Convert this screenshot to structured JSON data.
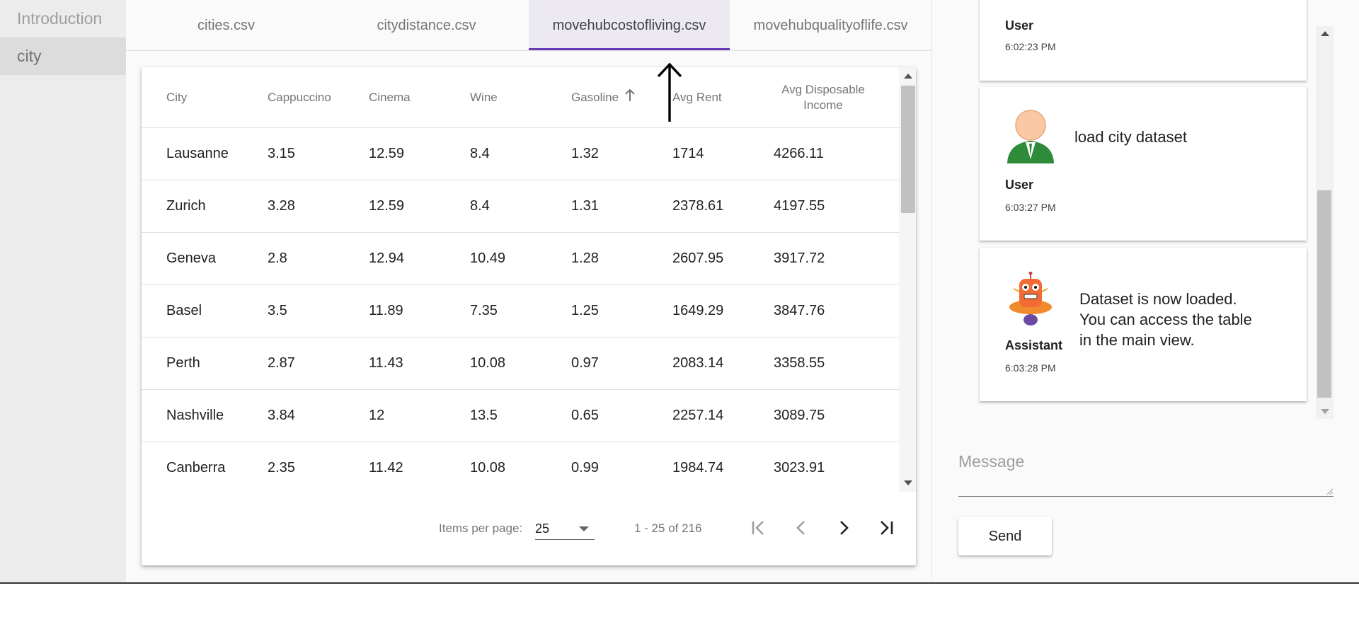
{
  "nav": {
    "items": [
      {
        "label": "Introduction"
      },
      {
        "label": "city"
      }
    ]
  },
  "tabs": [
    {
      "label": "cities.csv"
    },
    {
      "label": "citydistance.csv"
    },
    {
      "label": "movehubcostofliving.csv",
      "active": true
    },
    {
      "label": "movehubqualityoflife.csv"
    }
  ],
  "table": {
    "columns": [
      "City",
      "Cappuccino",
      "Cinema",
      "Wine",
      "Gasoline",
      "Avg Rent",
      "Avg Disposable Income"
    ],
    "sorted_column": "Gasoline",
    "rows": [
      [
        "Lausanne",
        "3.15",
        "12.59",
        "8.4",
        "1.32",
        "1714",
        "4266.11"
      ],
      [
        "Zurich",
        "3.28",
        "12.59",
        "8.4",
        "1.31",
        "2378.61",
        "4197.55"
      ],
      [
        "Geneva",
        "2.8",
        "12.94",
        "10.49",
        "1.28",
        "2607.95",
        "3917.72"
      ],
      [
        "Basel",
        "3.5",
        "11.89",
        "7.35",
        "1.25",
        "1649.29",
        "3847.76"
      ],
      [
        "Perth",
        "2.87",
        "11.43",
        "10.08",
        "0.97",
        "2083.14",
        "3358.55"
      ],
      [
        "Nashville",
        "3.84",
        "12",
        "13.5",
        "0.65",
        "2257.14",
        "3089.75"
      ],
      [
        "Canberra",
        "2.35",
        "11.42",
        "10.08",
        "0.99",
        "1984.74",
        "3023.91"
      ]
    ]
  },
  "paginator": {
    "items_per_page_label": "Items per page:",
    "page_size": "25",
    "range_label": "1 - 25 of 216"
  },
  "chat": {
    "messages": [
      {
        "role": "User",
        "time": "6:02:23 PM",
        "text": ""
      },
      {
        "role": "User",
        "time": "6:03:27 PM",
        "text": "load city dataset"
      },
      {
        "role": "Assistant",
        "time": "6:03:28 PM",
        "text_lines": [
          "Dataset is now loaded.",
          "You can access the table",
          "in the main view."
        ]
      }
    ],
    "message_placeholder": "Message",
    "send_label": "Send"
  },
  "colors": {
    "accent": "#673ab7",
    "active_tab_bg": "#ece9f3"
  }
}
